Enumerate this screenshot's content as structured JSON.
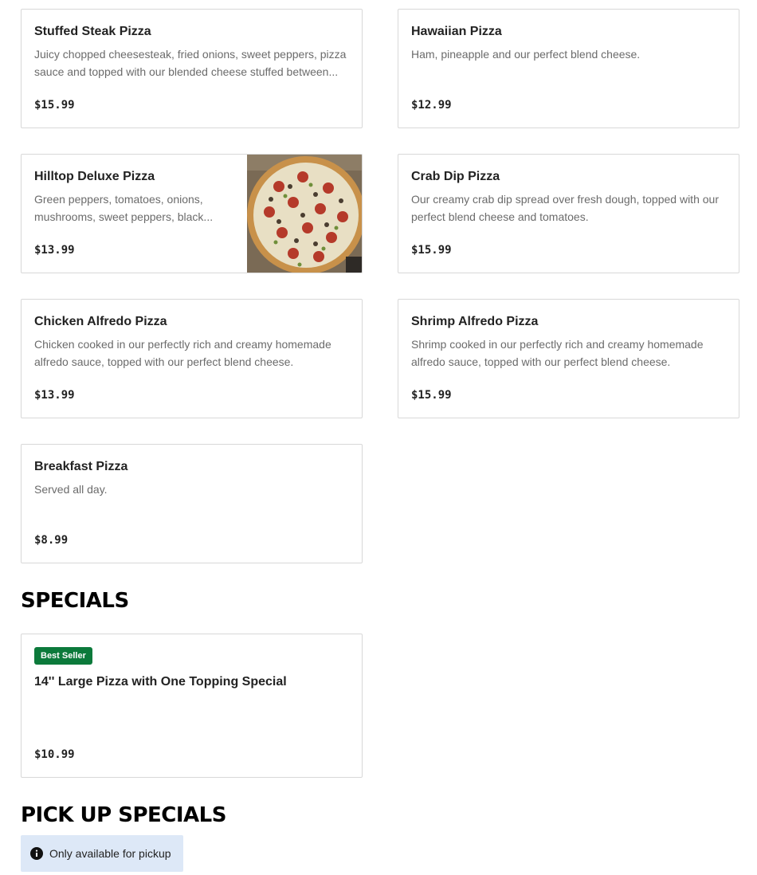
{
  "menu_items": [
    {
      "title": "Stuffed Steak Pizza",
      "desc": "Juicy chopped cheesesteak, fried onions, sweet peppers, pizza sauce and topped with our blended cheese stuffed between...",
      "price": "$15.99"
    },
    {
      "title": "Hawaiian Pizza",
      "desc": "Ham, pineapple and our perfect blend cheese.",
      "price": "$12.99"
    },
    {
      "title": "Hilltop Deluxe Pizza",
      "desc": "Green peppers, tomatoes, onions, mushrooms, sweet peppers, black...",
      "price": "$13.99",
      "image": "pizza-photo"
    },
    {
      "title": "Crab Dip Pizza",
      "desc": "Our creamy crab dip spread over fresh dough, topped with our perfect blend cheese and tomatoes.",
      "price": "$15.99"
    },
    {
      "title": "Chicken Alfredo Pizza",
      "desc": "Chicken cooked in our perfectly rich and creamy homemade alfredo sauce, topped with our perfect blend cheese.",
      "price": "$13.99"
    },
    {
      "title": "Shrimp Alfredo Pizza",
      "desc": "Shrimp cooked in our perfectly rich and creamy homemade alfredo sauce, topped with our perfect blend cheese.",
      "price": "$15.99"
    },
    {
      "title": "Breakfast Pizza",
      "desc": "Served all day.",
      "price": "$8.99"
    }
  ],
  "specials": {
    "heading": "SPECIALS",
    "item": {
      "badge": "Best Seller",
      "title": "14'' Large Pizza with One Topping Special",
      "price": "$10.99"
    }
  },
  "pickup_specials": {
    "heading": "PICK UP SPECIALS",
    "notice": "Only available for pickup",
    "notice_icon": "info-icon"
  },
  "colors": {
    "badge_green": "#0c7a3b",
    "notice_bg": "#dde8f7"
  }
}
